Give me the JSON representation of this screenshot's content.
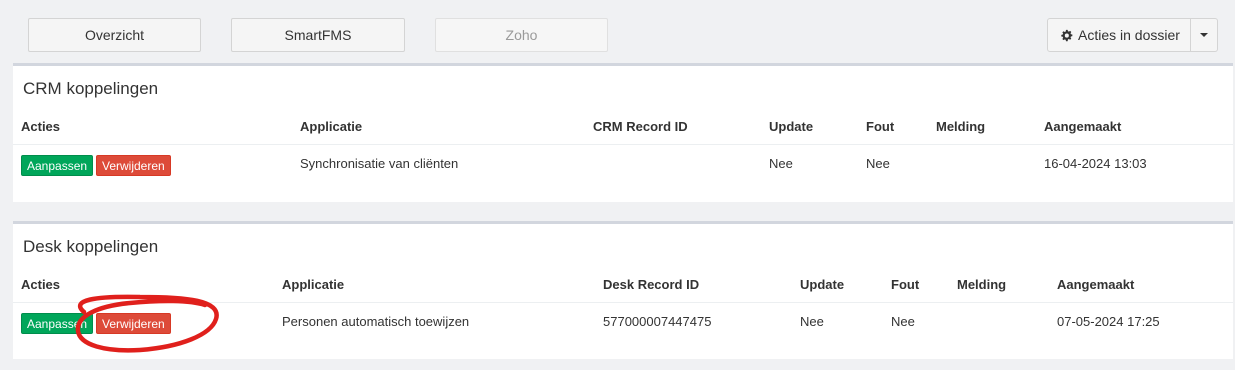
{
  "top_buttons": {
    "overzicht": "Overzicht",
    "smartfms": "SmartFMS",
    "zoho": "Zoho",
    "acties": "Acties in dossier"
  },
  "crm": {
    "title": "CRM koppelingen",
    "headers": [
      "Acties",
      "Applicatie",
      "CRM Record ID",
      "Update",
      "Fout",
      "Melding",
      "Aangemaakt"
    ],
    "row": {
      "edit": "Aanpassen",
      "delete": "Verwijderen",
      "applicatie": "Synchronisatie van cliënten",
      "record_id": "",
      "update": "Nee",
      "fout": "Nee",
      "melding": "",
      "aangemaakt": "16-04-2024 13:03"
    }
  },
  "desk": {
    "title": "Desk koppelingen",
    "headers": [
      "Acties",
      "Applicatie",
      "Desk Record ID",
      "Update",
      "Fout",
      "Melding",
      "Aangemaakt"
    ],
    "row": {
      "edit": "Aanpassen",
      "delete": "Verwijderen",
      "applicatie": "Personen automatisch toewijzen",
      "record_id": "577000007447475",
      "update": "Nee",
      "fout": "Nee",
      "melding": "",
      "aangemaakt": "07-05-2024 17:25"
    }
  },
  "colors": {
    "green": "#00a65a",
    "red": "#dd4b39",
    "annotation": "#e0201c"
  },
  "icons": [
    "gear-icon",
    "caret-down-icon"
  ]
}
